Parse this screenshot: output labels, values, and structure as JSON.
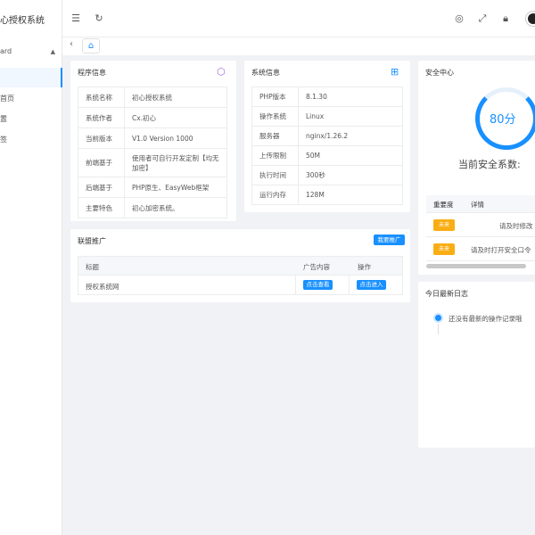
{
  "sidebar": {
    "brand": "心授权系统",
    "group_label": "ard",
    "items": [
      "首页",
      "置",
      "签"
    ]
  },
  "topbar": {
    "icons": [
      "menu-fold-icon",
      "refresh-icon",
      "theme-icon",
      "fullscreen-icon",
      "lock-icon"
    ]
  },
  "program_info": {
    "title": "程序信息",
    "rows": [
      {
        "key": "系统名称",
        "value": "初心授权系统"
      },
      {
        "key": "系统作者",
        "value": "Cx.初心"
      },
      {
        "key": "当前版本",
        "value": "V1.0 Version 1000"
      },
      {
        "key": "前端基于",
        "value": "使用者可自行开发定制【均无加密】"
      },
      {
        "key": "后端基于",
        "value": "PHP原生、EasyWeb框架"
      },
      {
        "key": "主要特色",
        "value": "初心加密系统。"
      }
    ]
  },
  "system_info": {
    "title": "系统信息",
    "rows": [
      {
        "key": "PHP版本",
        "value": "8.1.30"
      },
      {
        "key": "操作系统",
        "value": "Linux"
      },
      {
        "key": "服务器",
        "value": "nginx/1.26.2"
      },
      {
        "key": "上传限制",
        "value": "50M"
      },
      {
        "key": "执行时间",
        "value": "300秒"
      },
      {
        "key": "运行内存",
        "value": "128M"
      }
    ]
  },
  "security": {
    "title": "安全中心",
    "score": "80分",
    "score_fraction": 0.8,
    "score_label": "当前安全系数:",
    "col_importance": "重要度",
    "col_detail": "详情",
    "rows": [
      {
        "badge": "未来",
        "detail": "请及时修改"
      },
      {
        "badge": "未来",
        "detail": "请及时打开安全口令"
      }
    ]
  },
  "promo": {
    "title": "联盟推广",
    "button": "我要推广",
    "headers": [
      "标题",
      "广告内容",
      "操作"
    ],
    "rows": [
      {
        "title": "授权系统网",
        "content_btn": "点击查看",
        "action_btn": "点击进入"
      }
    ]
  },
  "log": {
    "title": "今日最新日志",
    "empty_text": "还没有最新的操作记录哦"
  },
  "colors": {
    "primary": "#1890ff",
    "warning": "#faad14"
  }
}
